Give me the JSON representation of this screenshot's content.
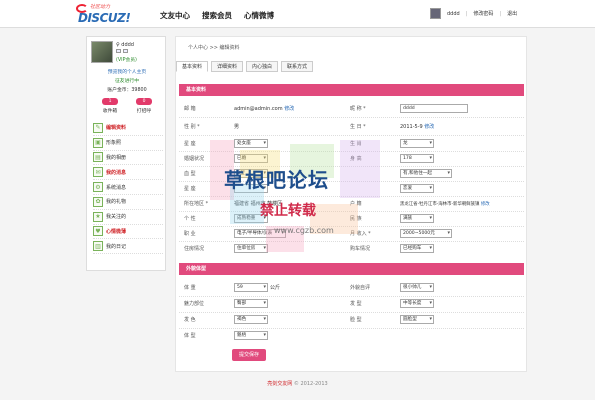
{
  "logo": {
    "tagline": "社区动力",
    "brand": "DISCUZ!"
  },
  "nav": {
    "items": [
      "文友中心",
      "搜索会员",
      "心情微博"
    ]
  },
  "user_nav": {
    "username": "dddd",
    "password_link": "修改密码",
    "logout_link": "退出"
  },
  "sidebar": {
    "name": "dddd",
    "vip": "(VIP会员)",
    "preview_link": "预览我的个人主页",
    "status": "征友进行中",
    "account": "账户金币：39800",
    "counts": [
      {
        "value": "1",
        "label": "收件箱"
      },
      {
        "value": "0",
        "label": "打招呼"
      }
    ],
    "menu": [
      {
        "label": "编辑资料",
        "icon": "edit-icon",
        "highlight": true
      },
      {
        "label": "形象照",
        "icon": "photo-icon",
        "highlight": false
      },
      {
        "label": "我的相册",
        "icon": "album-icon",
        "highlight": false
      },
      {
        "label": "我的消息",
        "icon": "message-icon",
        "highlight": true
      },
      {
        "label": "系统消息",
        "icon": "system-icon",
        "highlight": false
      },
      {
        "label": "我的礼物",
        "icon": "gift-icon",
        "highlight": false
      },
      {
        "label": "我关注的",
        "icon": "follow-icon",
        "highlight": false
      },
      {
        "label": "心情微薄",
        "icon": "mood-icon",
        "highlight": true
      },
      {
        "label": "我的日记",
        "icon": "diary-icon",
        "highlight": false
      }
    ]
  },
  "breadcrumb": "个人中心 >> 编辑资料",
  "tabs": [
    "基本资料",
    "详细资料",
    "内心独白",
    "联系方式"
  ],
  "basic": {
    "section_title": "基本资料",
    "email_label": "邮 箱",
    "email_value": "admin@admin.com",
    "email_edit": "修改",
    "nick_label": "昵 称 *",
    "nick_value": "dddd",
    "gender_label": "性 别 *",
    "gender_value": "男",
    "birth_label": "生 日 *",
    "birth_value": "2011-5-9",
    "birth_edit": "修改",
    "rows": [
      {
        "l_label": "星 座",
        "l_value": "处女座",
        "r_label": "生 肖",
        "r_value": "龙"
      },
      {
        "l_label": "婚姻状况",
        "l_value": "已婚",
        "r_label": "身 高",
        "r_value": "178"
      },
      {
        "l_label": "血 型",
        "l_value": "B型",
        "r_label": "",
        "r_value": "有,和他住一起"
      },
      {
        "l_label": "星 座",
        "l_value": "",
        "r_label": "",
        "r_value": "恋爱"
      },
      {
        "l_label": "所在地区 *",
        "l_value": "福建省 福州市 鼓楼区",
        "r_label": "户 籍",
        "r_value": "黑龙江省-牡丹江市-海林市-新华朝鲜族镇"
      },
      {
        "l_label": "个 性",
        "l_value": "成熟稳重",
        "r_label": "民 族",
        "r_value": "满族"
      },
      {
        "l_label": "职 业",
        "l_value": "电子/半导体/仪表",
        "r_label": "月 收入 *",
        "r_value": "2000~5000元"
      },
      {
        "l_label": "住房情况",
        "l_value": "住单位房",
        "r_label": "购车情况",
        "r_value": "已经购车"
      }
    ],
    "residence_edit": "修改"
  },
  "appearance": {
    "section_title": "外貌体型",
    "weight_label": "体 重",
    "weight_value": "59",
    "weight_unit": "公斤",
    "look_label": "外貌自评",
    "look_value": "很小帅儿",
    "charm_label": "魅力部位",
    "charm_value": "臀部",
    "hair_label": "发 型",
    "hair_value": "中等长度",
    "haircolor_label": "发 色",
    "haircolor_value": "褐色",
    "face_label": "脸 型",
    "face_value": "圆脸型",
    "body_label": "体 型",
    "body_value": "魁梧"
  },
  "save_button": "提交保存",
  "footer": {
    "brand": "亮剑交友网",
    "copy": "© 2012-2013"
  },
  "watermark": {
    "line1": "草根吧论坛",
    "line2": "禁止转载",
    "line3": "www.cgzb.com"
  }
}
